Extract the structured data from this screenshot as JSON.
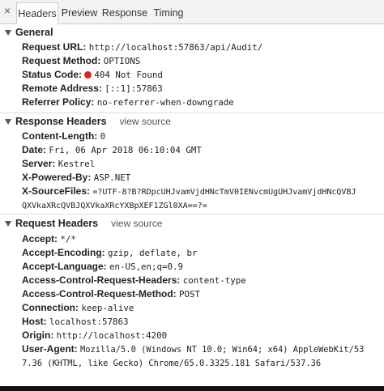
{
  "tabs": {
    "close": "×",
    "headers": "Headers",
    "preview": "Preview",
    "response": "Response",
    "timing": "Timing"
  },
  "general": {
    "title": "General",
    "request_url": {
      "key": "Request URL:",
      "value": "http://localhost:57863/api/Audit/"
    },
    "request_method": {
      "key": "Request Method:",
      "value": "OPTIONS"
    },
    "status_code": {
      "key": "Status Code:",
      "value": "404 Not Found",
      "color": "#d9241f"
    },
    "remote_address": {
      "key": "Remote Address:",
      "value": "[::1]:57863"
    },
    "referrer_policy": {
      "key": "Referrer Policy:",
      "value": "no-referrer-when-downgrade"
    }
  },
  "response_headers": {
    "title": "Response Headers",
    "view_source": "view source",
    "content_length": {
      "key": "Content-Length:",
      "value": "0"
    },
    "date": {
      "key": "Date:",
      "value": "Fri, 06 Apr 2018 06:10:04 GMT"
    },
    "server": {
      "key": "Server:",
      "value": "Kestrel"
    },
    "x_powered_by": {
      "key": "X-Powered-By:",
      "value": "ASP.NET"
    },
    "x_sourcefiles": {
      "key": "X-SourceFiles:",
      "value": "=?UTF-8?B?RDpcUHJvamVjdHNcTmV0IENvcmUgUHJvamVjdHNcQVBJ",
      "value_cont": "QXVkaXRcQVBJQXVkaXRcYXBpXEF1ZGl0XA==?="
    }
  },
  "request_headers": {
    "title": "Request Headers",
    "view_source": "view source",
    "accept": {
      "key": "Accept:",
      "value": "*/*"
    },
    "accept_encoding": {
      "key": "Accept-Encoding:",
      "value": "gzip, deflate, br"
    },
    "accept_language": {
      "key": "Accept-Language:",
      "value": "en-US,en;q=0.9"
    },
    "acrh": {
      "key": "Access-Control-Request-Headers:",
      "value": "content-type"
    },
    "acrm": {
      "key": "Access-Control-Request-Method:",
      "value": "POST"
    },
    "connection": {
      "key": "Connection:",
      "value": "keep-alive"
    },
    "host": {
      "key": "Host:",
      "value": "localhost:57863"
    },
    "origin": {
      "key": "Origin:",
      "value": "http://localhost:4200"
    },
    "user_agent": {
      "key": "User-Agent:",
      "value": "Mozilla/5.0 (Windows NT 10.0; Win64; x64) AppleWebKit/53",
      "value_cont": "7.36 (KHTML, like Gecko) Chrome/65.0.3325.181 Safari/537.36"
    }
  }
}
